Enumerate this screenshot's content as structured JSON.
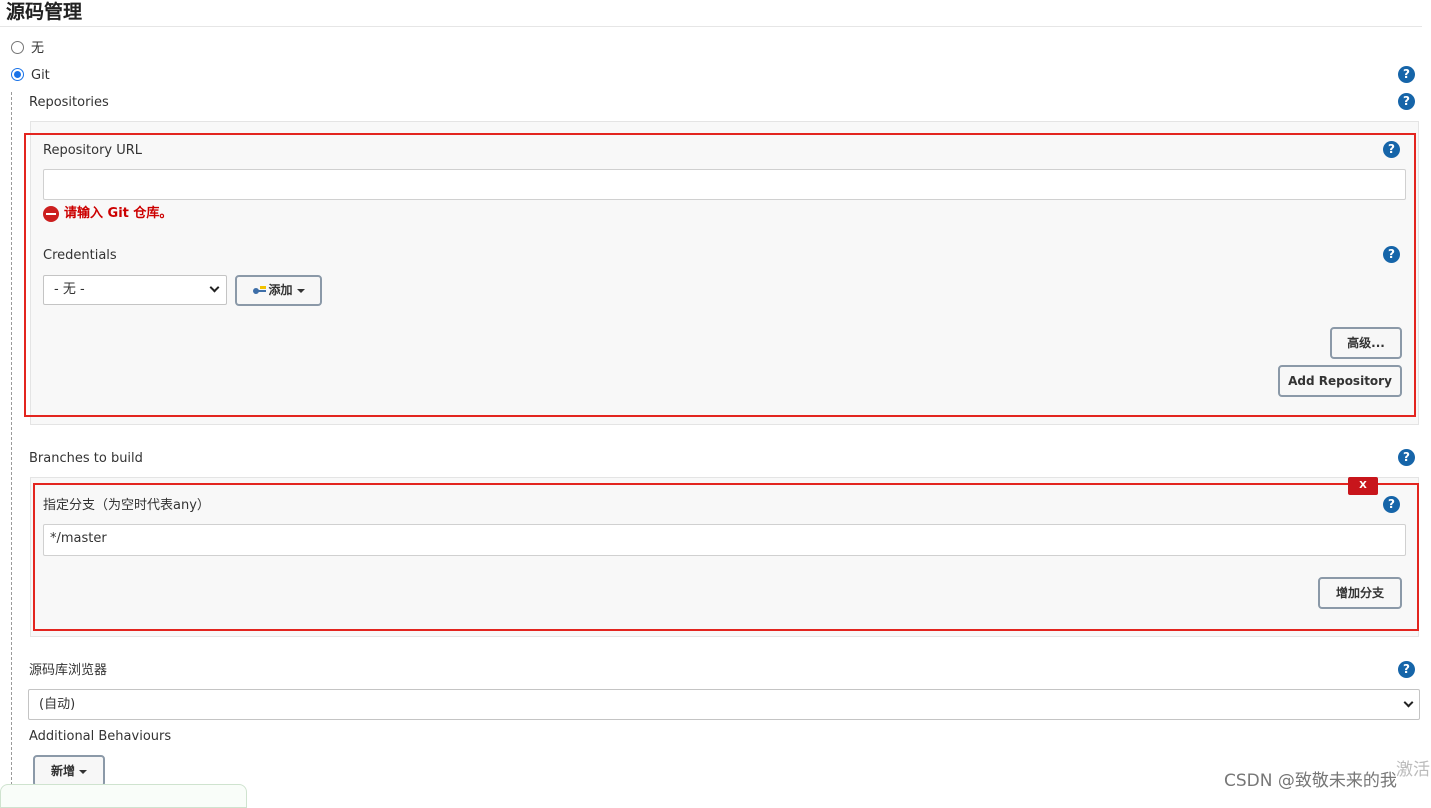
{
  "section": {
    "title": "源码管理"
  },
  "scm": {
    "options": [
      {
        "label": "无",
        "selected": false
      },
      {
        "label": "Git",
        "selected": true
      }
    ],
    "help": "?"
  },
  "repositories": {
    "label": "Repositories",
    "url_label": "Repository URL",
    "url_value": "",
    "url_error": "请输入 Git 仓库。",
    "credentials_label": "Credentials",
    "credentials_selected": "- 无 -",
    "add_button": "添加",
    "add_button_icon": "key-icon",
    "advanced_button": "高级...",
    "add_repository_button": "Add Repository"
  },
  "branches": {
    "label": "Branches to build",
    "delete_button": "X",
    "branch_label": "指定分支（为空时代表any）",
    "branch_value": "*/master",
    "add_branch_button": "增加分支"
  },
  "browser": {
    "label": "源码库浏览器",
    "selected": "(自动)"
  },
  "behaviours": {
    "label": "Additional Behaviours",
    "add_button": "新增"
  },
  "overlay": {
    "watermark": "CSDN @致敬未来的我",
    "activate_text": "激活"
  },
  "colors": {
    "help_icon": "#1665a9",
    "error": "#cc0000",
    "highlight_box": "#e3251f",
    "radio_accent": "#1a73e8"
  }
}
